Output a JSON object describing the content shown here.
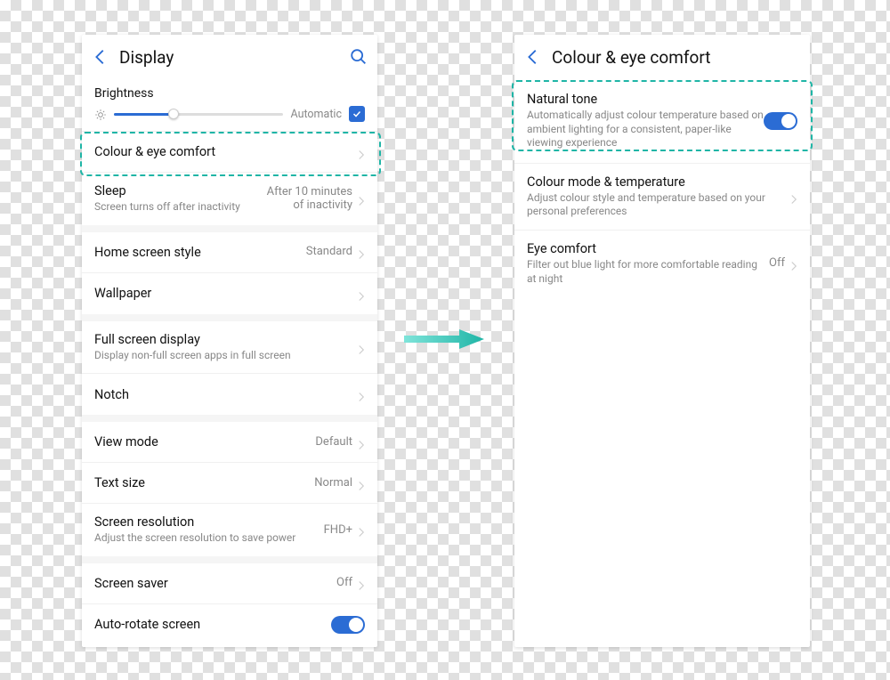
{
  "left": {
    "title": "Display",
    "brightness": {
      "label": "Brightness",
      "auto": "Automatic"
    },
    "rows": [
      {
        "title": "Colour & eye comfort",
        "sub": "",
        "value": ""
      },
      {
        "title": "Sleep",
        "sub": "Screen turns off after inactivity",
        "value": "After 10 minutes of inactivity"
      },
      {
        "title": "Home screen style",
        "sub": "",
        "value": "Standard"
      },
      {
        "title": "Wallpaper",
        "sub": "",
        "value": ""
      },
      {
        "title": "Full screen display",
        "sub": "Display non-full screen apps in full screen",
        "value": ""
      },
      {
        "title": "Notch",
        "sub": "",
        "value": ""
      },
      {
        "title": "View mode",
        "sub": "",
        "value": "Default"
      },
      {
        "title": "Text size",
        "sub": "",
        "value": "Normal"
      },
      {
        "title": "Screen resolution",
        "sub": "Adjust the screen resolution to save power",
        "value": "FHD+"
      },
      {
        "title": "Screen saver",
        "sub": "",
        "value": "Off"
      },
      {
        "title": "Auto-rotate screen",
        "sub": "",
        "value": "",
        "toggle": true
      }
    ]
  },
  "right": {
    "title": "Colour & eye comfort",
    "rows": [
      {
        "title": "Natural tone",
        "sub": "Automatically adjust colour temperature based on ambient lighting for a consistent, paper-like viewing experience",
        "value": "",
        "toggle": true
      },
      {
        "title": "Colour mode & temperature",
        "sub": "Adjust colour style and temperature based on your personal preferences",
        "value": ""
      },
      {
        "title": "Eye comfort",
        "sub": "Filter out blue light for more comfortable reading at night",
        "value": "Off"
      }
    ]
  }
}
